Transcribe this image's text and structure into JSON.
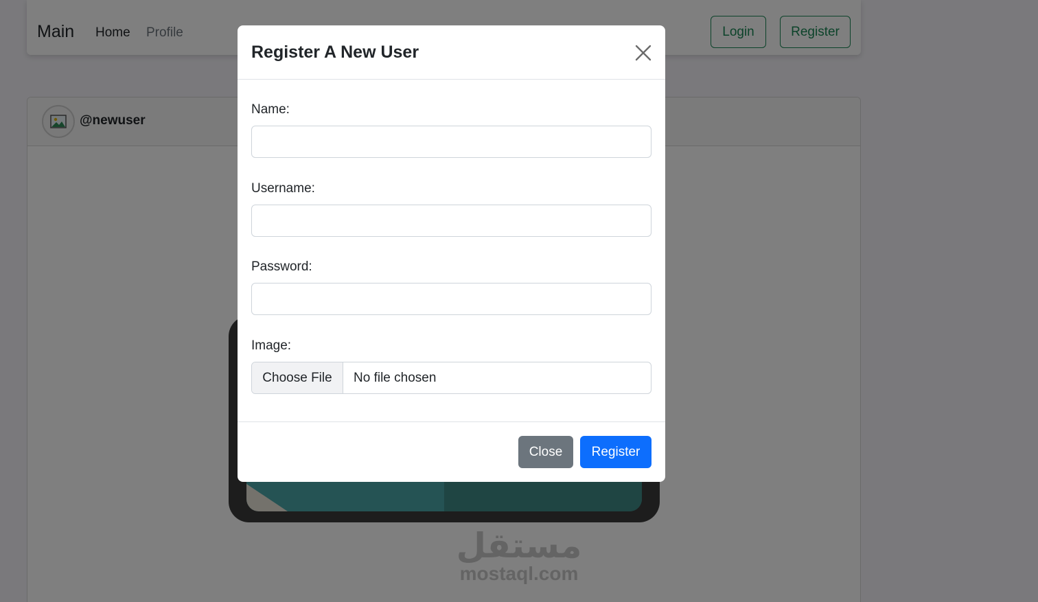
{
  "navbar": {
    "brand": "Main",
    "links": [
      {
        "label": "Home"
      },
      {
        "label": "Profile"
      }
    ],
    "login_label": "Login",
    "register_label": "Register"
  },
  "post": {
    "username": "@newuser"
  },
  "watermark": {
    "arabic": "مستقل",
    "latin": "mostaql.com"
  },
  "modal": {
    "title": "Register A New User",
    "fields": {
      "name_label": "Name:",
      "name_value": "",
      "username_label": "Username:",
      "username_value": "",
      "password_label": "Password:",
      "password_value": "",
      "image_label": "Image:",
      "file_button": "Choose File",
      "file_status": "No file chosen"
    },
    "footer": {
      "close_label": "Close",
      "register_label": "Register"
    }
  },
  "colors": {
    "primary": "#0d6efd",
    "secondary": "#6c757d",
    "success": "#198754"
  }
}
